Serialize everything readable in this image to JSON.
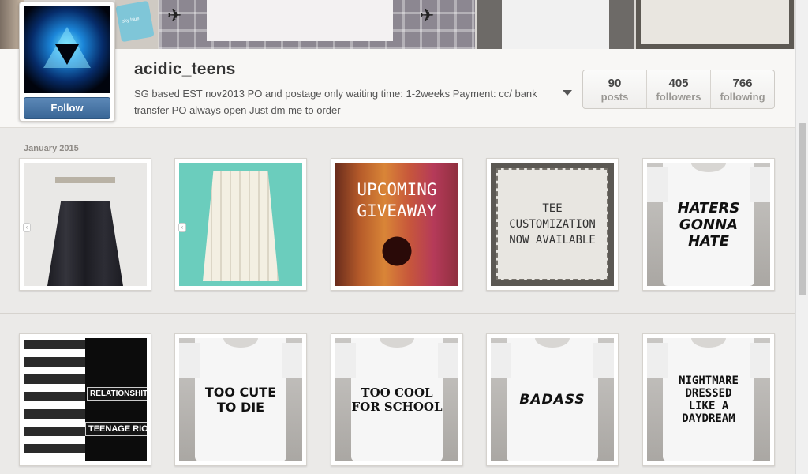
{
  "cover": {
    "pouch_text": "sky blue"
  },
  "profile": {
    "username": "acidic_teens",
    "bio": "SG based EST nov2013 PO and postage only waiting time: 1-2weeks Payment: cc/ bank transfer PO always open Just dm me to order",
    "follow_label": "Follow",
    "stats": [
      {
        "num": "90",
        "label": "posts"
      },
      {
        "num": "405",
        "label": "followers"
      },
      {
        "num": "766",
        "label": "following"
      }
    ]
  },
  "feed": {
    "month": "January 2015",
    "row1": [
      {
        "kind": "skirt-dark",
        "text": ""
      },
      {
        "kind": "skirt-mint",
        "text": ""
      },
      {
        "kind": "giveaway",
        "text": "UPCOMING\nGIVEAWAY"
      },
      {
        "kind": "tee-custom",
        "text": "TEE\nCUSTOMIZATION\nNOW AVAILABLE"
      },
      {
        "kind": "shirt",
        "text": "HATERS\nGONNA\nHATE"
      }
    ],
    "row2": [
      {
        "kind": "collage",
        "text": "RELATIONSHIT.",
        "text2": "TEENAGE RIOT"
      },
      {
        "kind": "shirt",
        "text": "TOO CUTE\nTO DIE"
      },
      {
        "kind": "shirt",
        "text": "TOO COOL\nFOR SCHOOL"
      },
      {
        "kind": "shirt",
        "text": "BADASS"
      },
      {
        "kind": "shirt",
        "text": "NIGHTMARE\nDRESSED\nLIKE A\nDAYDREAM"
      }
    ]
  },
  "colors": {
    "follow_button": "#3f6d9c",
    "background": "#ebeae8"
  }
}
